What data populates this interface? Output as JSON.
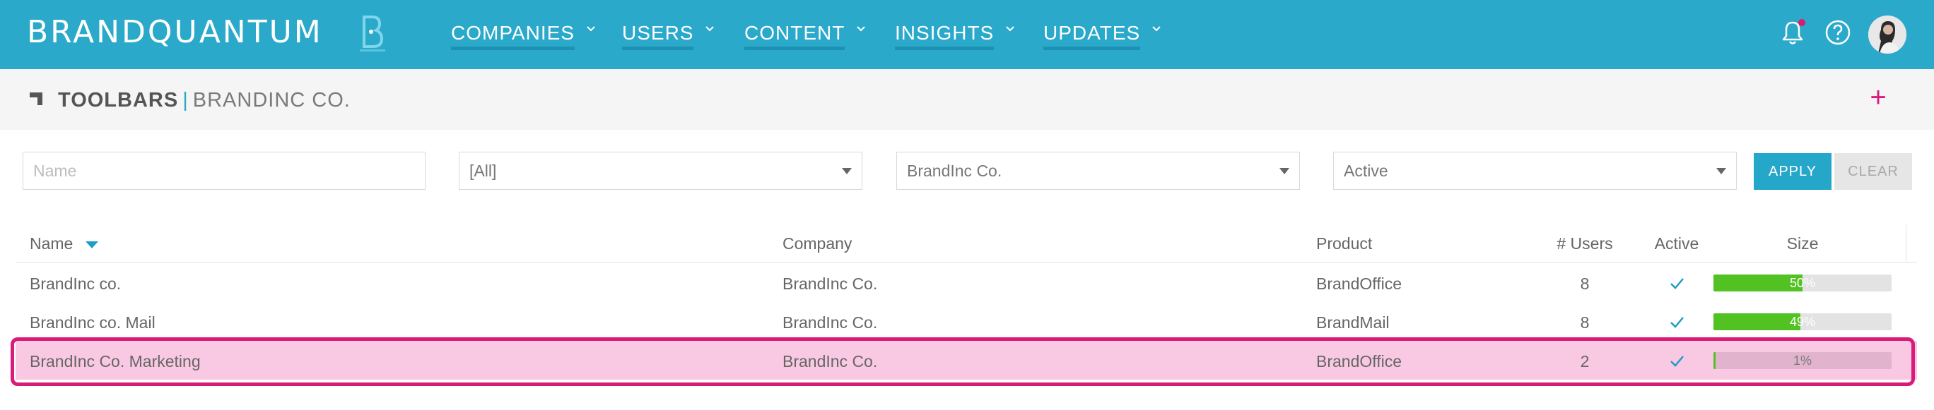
{
  "brand": {
    "name": "BRANDQUANTUM"
  },
  "nav": {
    "items": [
      {
        "label": "COMPANIES"
      },
      {
        "label": "USERS"
      },
      {
        "label": "CONTENT"
      },
      {
        "label": "INSIGHTS"
      },
      {
        "label": "UPDATES"
      }
    ],
    "notification_icon": "bell-icon",
    "help_icon": "help-circle-icon",
    "has_unread_notifications": true
  },
  "page": {
    "title": "TOOLBARS",
    "separator": "|",
    "subtitle": "BRANDINC CO.",
    "add_icon": "+"
  },
  "filters": {
    "name_placeholder": "Name",
    "name_value": "",
    "selects": [
      {
        "value": "[All]"
      },
      {
        "value": "BrandInc Co."
      },
      {
        "value": "Active"
      }
    ],
    "apply_label": "APPLY",
    "clear_label": "CLEAR"
  },
  "table": {
    "columns": {
      "name": "Name",
      "company": "Company",
      "product": "Product",
      "users": "# Users",
      "active": "Active",
      "size": "Size"
    },
    "sort": {
      "column": "Name",
      "direction": "desc"
    },
    "rows": [
      {
        "name": "BrandInc co.",
        "company": "BrandInc Co.",
        "product": "BrandOffice",
        "users": "8",
        "active": true,
        "size_label": "50%",
        "size_pct": 50,
        "selected": false
      },
      {
        "name": "BrandInc co. Mail",
        "company": "BrandInc Co.",
        "product": "BrandMail",
        "users": "8",
        "active": true,
        "size_label": "49%",
        "size_pct": 49,
        "selected": false
      },
      {
        "name": "BrandInc Co. Marketing",
        "company": "BrandInc Co.",
        "product": "BrandOffice",
        "users": "2",
        "active": true,
        "size_label": "1%",
        "size_pct": 1,
        "selected": true
      }
    ]
  },
  "colors": {
    "navbar": "#2aa9cb",
    "accent_pink": "#d81b7a",
    "selected_row": "#f9c9e3",
    "progress_green": "#52c222",
    "check_blue": "#1f9dc4"
  }
}
